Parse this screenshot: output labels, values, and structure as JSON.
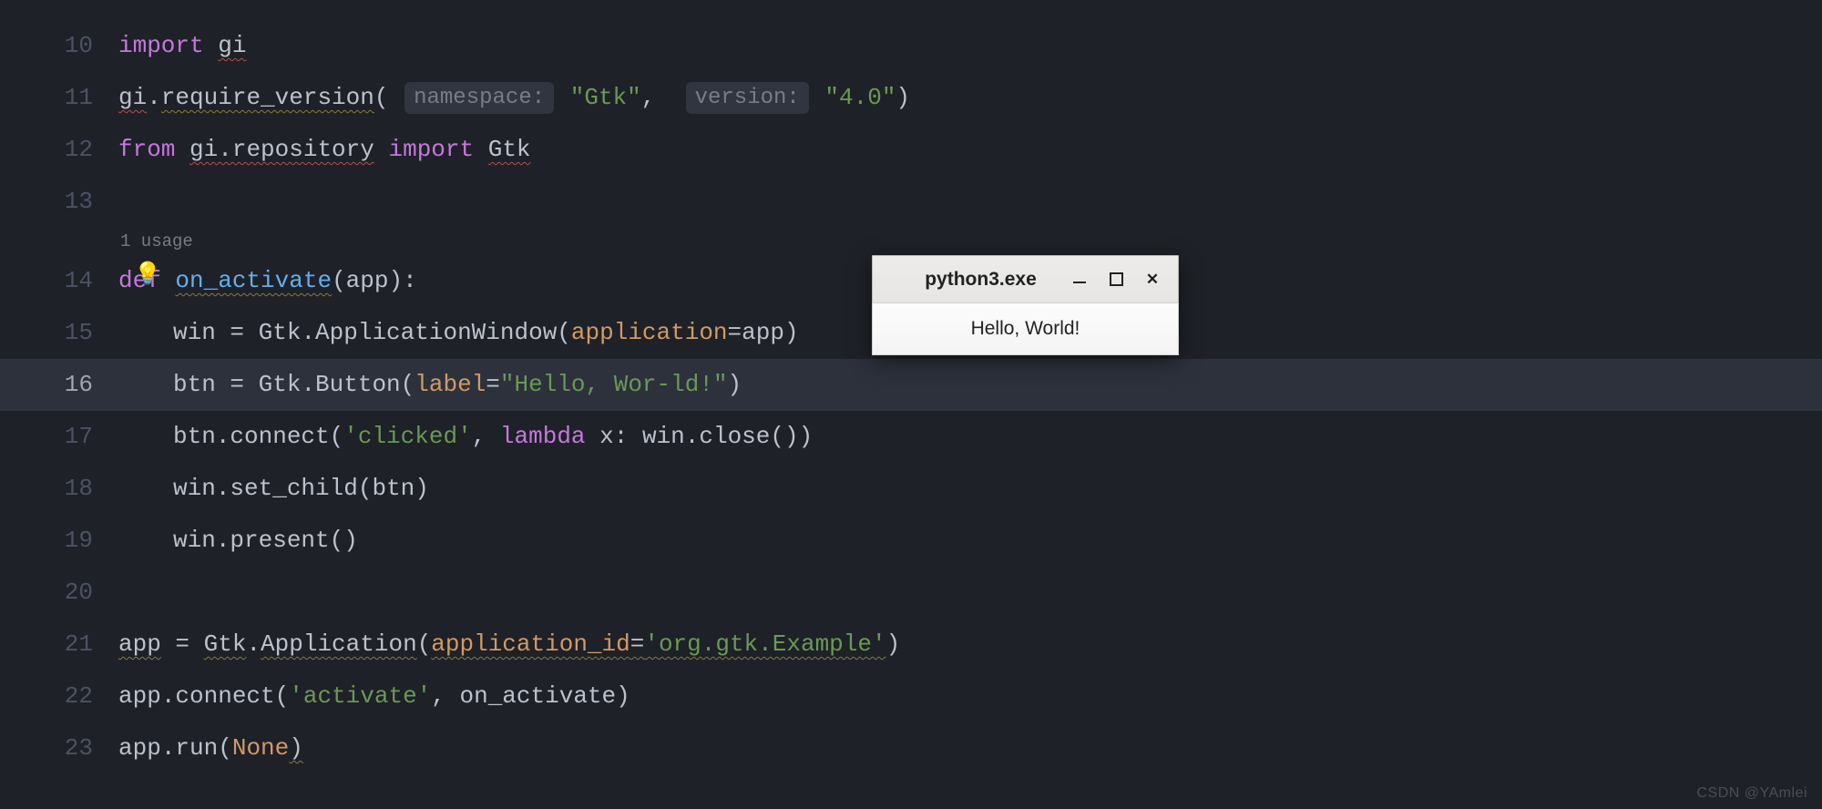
{
  "editor": {
    "gutter_lines": [
      "10",
      "11",
      "12",
      "13",
      "14",
      "15",
      "16",
      "17",
      "18",
      "19",
      "20",
      "21",
      "22",
      "23"
    ],
    "current_line": "16",
    "usage_hint": "1 usage",
    "bulb_icon": "💡",
    "code": {
      "l10": {
        "import": "import",
        "gi": "gi"
      },
      "l11": {
        "gi": "gi",
        "dot": ".",
        "fn": "require_version",
        "op": "(",
        "h1": "namespace:",
        "s1": "\"Gtk\"",
        "comma": ",",
        "h2": "version:",
        "s2": "\"4.0\"",
        "cp": ")"
      },
      "l12": {
        "from": "from",
        "mod": "gi.repository",
        "import": "import",
        "gtk": "Gtk"
      },
      "l14": {
        "def": "def",
        "name": "on_activate",
        "op": "(",
        "p": "app",
        "cp": "):"
      },
      "l15": {
        "win": "win",
        "eq": " = ",
        "gtk": "Gtk",
        "dot": ".",
        "cls": "ApplicationWindow",
        "op": "(",
        "kw": "application",
        "eq2": "=",
        "arg": "app",
        "cp": ")"
      },
      "l16": {
        "btn": "btn",
        "eq": " = ",
        "gtk": "Gtk",
        "dot": ".",
        "cls": "Button",
        "op": "(",
        "kw": "label",
        "eq2": "=",
        "s": "\"Hello, Wor-ld!\"",
        "cp": ")"
      },
      "l17": {
        "btn": "btn",
        "dot": ".",
        "fn": "connect",
        "op": "(",
        "s": "'clicked'",
        "comma": ", ",
        "lam": "lambda",
        "x": " x: ",
        "win": "win",
        "dot2": ".",
        "close": "close",
        "p2": "()",
        "cp": ")"
      },
      "l18": {
        "win": "win",
        "dot": ".",
        "fn": "set_child",
        "op": "(",
        "arg": "btn",
        "cp": ")"
      },
      "l19": {
        "win": "win",
        "dot": ".",
        "fn": "present",
        "p": "()"
      },
      "l21": {
        "app": "app",
        "eq": " = ",
        "gtk": "Gtk",
        "dot": ".",
        "cls": "Application",
        "op": "(",
        "kw": "application_id",
        "eq2": "=",
        "s": "'org.gtk.Example'",
        "cp": ")"
      },
      "l22": {
        "app": "app",
        "dot": ".",
        "fn": "connect",
        "op": "(",
        "s": "'activate'",
        "comma": ", ",
        "arg": "on_activate",
        "cp": ")"
      },
      "l23": {
        "app": "app",
        "dot": ".",
        "fn": "run",
        "op": "(",
        "none": "None",
        "cp": ")"
      }
    }
  },
  "popup": {
    "title": "python3.exe",
    "button_label": "Hello, World!"
  },
  "watermark": "CSDN @YAmlei"
}
